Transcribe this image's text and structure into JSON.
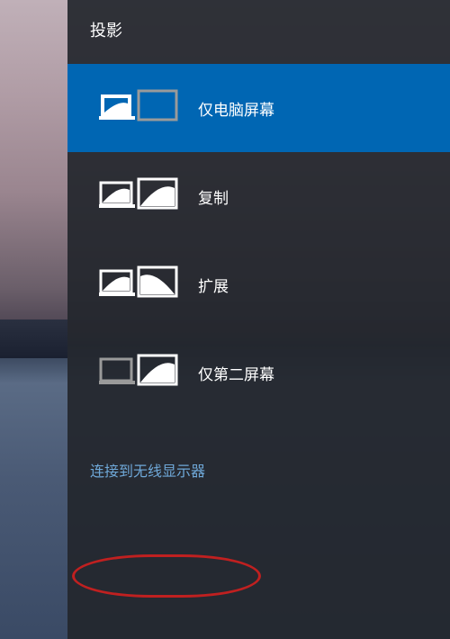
{
  "panel": {
    "title": "投影",
    "options": [
      {
        "label": "仅电脑屏幕",
        "selected": true
      },
      {
        "label": "复制",
        "selected": false
      },
      {
        "label": "扩展",
        "selected": false
      },
      {
        "label": "仅第二屏幕",
        "selected": false
      }
    ],
    "wireless_link": "连接到无线显示器"
  }
}
